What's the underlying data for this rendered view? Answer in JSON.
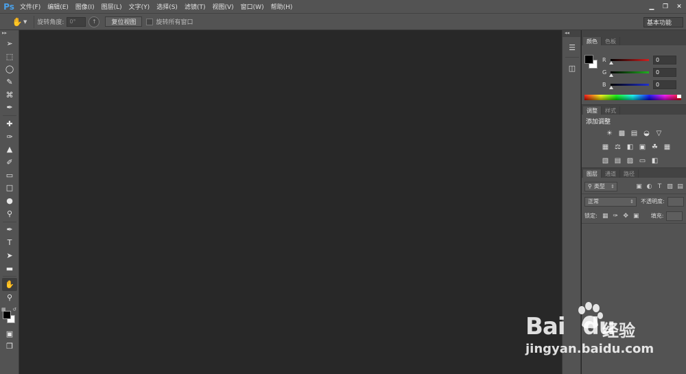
{
  "app": {
    "logo": "Ps"
  },
  "menu": [
    "文件(F)",
    "编辑(E)",
    "图像(I)",
    "图层(L)",
    "文字(Y)",
    "选择(S)",
    "滤镜(T)",
    "视图(V)",
    "窗口(W)",
    "帮助(H)"
  ],
  "window_controls": {
    "minimize": "▁",
    "restore": "❐",
    "close": "✕"
  },
  "options": {
    "tool_icon": "rotate-view-icon",
    "rotation_label": "旋转角度:",
    "rotation_value": "0°",
    "reset_button": "复位视图",
    "rotate_all_label": "旋转所有窗口",
    "workspace": "基本功能"
  },
  "toolbar": {
    "tools": [
      "move-icon",
      "marquee-icon",
      "lasso-icon",
      "quick-select-icon",
      "crop-icon",
      "eyedropper-icon",
      "healing-brush-icon",
      "brush-icon",
      "clone-stamp-icon",
      "history-brush-icon",
      "eraser-icon",
      "gradient-icon",
      "blur-icon",
      "dodge-icon",
      "pen-icon",
      "type-icon",
      "path-select-icon",
      "rectangle-icon",
      "rotate-view-icon",
      "zoom-icon"
    ],
    "type_tool_glyph": "T",
    "active_tool": "rotate-view-icon",
    "foreground_color": "#000000",
    "background_color": "#ffffff"
  },
  "color_panel": {
    "tabs": [
      "颜色",
      "色板"
    ],
    "active_tab": "颜色",
    "channels": [
      {
        "label": "R",
        "value": "0",
        "color": "#d02020"
      },
      {
        "label": "G",
        "value": "0",
        "color": "#20b020"
      },
      {
        "label": "B",
        "value": "0",
        "color": "#2030d0"
      }
    ]
  },
  "adjustments_panel": {
    "tabs": [
      "调整",
      "样式"
    ],
    "active_tab": "调整",
    "title": "添加调整"
  },
  "layers_panel": {
    "tabs": [
      "图层",
      "通道",
      "路径"
    ],
    "active_tab": "图层",
    "filter_kind": "类型",
    "blend_mode": "正常",
    "opacity_label": "不透明度:",
    "lock_label": "锁定:",
    "fill_label": "填充:"
  },
  "watermark": {
    "brand": "Bai",
    "brand_tail": "du",
    "product": "经验",
    "url": "jingyan.baidu.com"
  }
}
